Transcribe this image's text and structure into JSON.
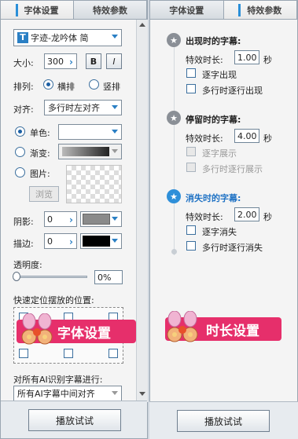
{
  "left": {
    "tabs": [
      "字体设置",
      "特效参数"
    ],
    "font_select": "字迹-龙吟体 简",
    "font_icon": "T",
    "size_label": "大小:",
    "size_value": "300",
    "bold_label": "B",
    "italic_label": "I",
    "arrange_label": "排列:",
    "arrange_opts": [
      "横排",
      "竖排"
    ],
    "align_label": "对齐:",
    "align_value": "多行时左对齐",
    "single_label": "单色:",
    "gradient_label": "渐变:",
    "image_label": "图片:",
    "browse_label": "浏览",
    "shadow_label": "阴影:",
    "shadow_value": "0",
    "stroke_label": "描边:",
    "stroke_value": "0",
    "opacity_label": "透明度:",
    "opacity_value": "0%",
    "quickpos_label": "快速定位摆放的位置:",
    "ai_label": "对所有AI识别字幕进行:",
    "ai_value": "所有AI字幕中间对齐",
    "badge_text": "字体设置",
    "play_label": "播放试试"
  },
  "right": {
    "tabs": [
      "字体设置",
      "特效参数"
    ],
    "sections": [
      {
        "title": "出现时的字幕:",
        "duration_label": "特效时长:",
        "duration_value": "1.00",
        "unit": "秒",
        "opt1": "逐字出现",
        "opt2": "多行时逐行出现"
      },
      {
        "title": "停留时的字幕:",
        "duration_label": "特效时长:",
        "duration_value": "4.00",
        "unit": "秒",
        "opt1": "逐字展示",
        "opt2": "多行时逐行展示"
      },
      {
        "title": "消失时的字幕:",
        "duration_label": "特效时长:",
        "duration_value": "2.00",
        "unit": "秒",
        "opt1": "逐字消失",
        "opt2": "多行时逐行消失"
      }
    ],
    "badge_text": "时长设置",
    "play_label": "播放试试"
  },
  "colors": {
    "accent": "#2a8fd8",
    "badge": "#e62f6b"
  }
}
